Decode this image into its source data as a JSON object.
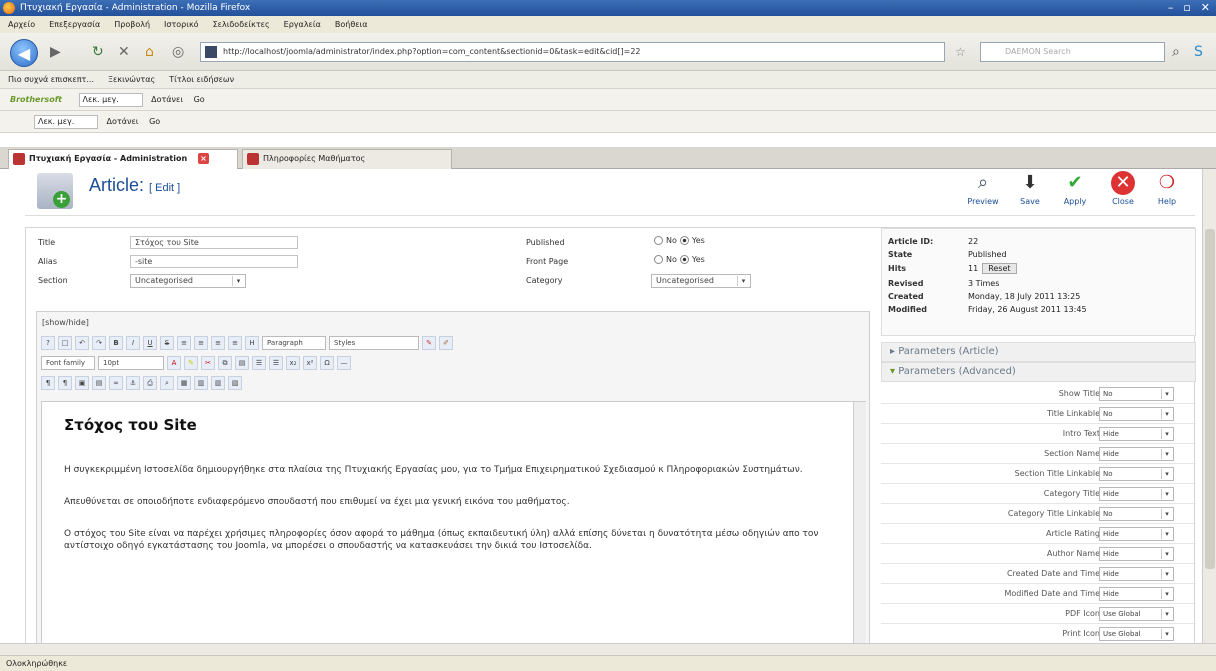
{
  "window": {
    "title": "Πτυχιακή Εργασία - Administration - Mozilla Firefox"
  },
  "menu": [
    "Αρχείο",
    "Επεξεργασία",
    "Προβολή",
    "Ιστορικό",
    "Σελιδοδείκτες",
    "Εργαλεία",
    "Βοήθεια"
  ],
  "nav": {
    "url": "http://localhost/joomla/administrator/index.php?option=com_content&sectionid=0&task=edit&cid[]=22",
    "search_placeholder": "DAEMON Search"
  },
  "bookmarks": [
    "Πιο συχνά επισκεπτ...",
    "Ξεκινώντας",
    "Τίτλοι ειδήσεων"
  ],
  "toolbar1": {
    "brand": "Brothersoft",
    "field": "Λεκ. μεγ.",
    "button": "Δοτάνει",
    "go": "Go"
  },
  "toolbar2": {
    "field": "Λεκ. μεγ.",
    "button": "Δοτάνει",
    "go": "Go"
  },
  "tabs": [
    "Πτυχιακή Εργασία - Administration",
    "Πληροφορίες Μαθήματος"
  ],
  "page": {
    "title": "Article:",
    "subtitle": "[ Edit ]",
    "buttons": [
      "Preview",
      "Save",
      "Apply",
      "Close",
      "Help"
    ]
  },
  "form": {
    "title_label": "Title",
    "title_value": "Στόχος του Site",
    "alias_label": "Alias",
    "alias_value": "-site",
    "section_label": "Section",
    "section_value": "Uncategorised",
    "published_label": "Published",
    "front_label": "Front Page",
    "category_label": "Category",
    "no": "No",
    "yes": "Yes",
    "category_value": "Uncategorised"
  },
  "editor": {
    "toggle": "[show/hide]",
    "paragraph": "Paragraph",
    "styles": "Styles",
    "font_family": "Font family",
    "font_size": "10pt",
    "heading": "Στόχος του Site",
    "p1": "Η συγκεκριμμένη Ιστοσελίδα δημιουργήθηκε στα πλαίσια της Πτυχιακής Εργασίας μου, για το Τμήμα Επιχειρηματικού Σχεδιασμού κ Πληροφοριακών Συστημάτων.",
    "p2": "Απευθύνεται σε οποιοδήποτε ενδιαφερόμενο σπουδαστή που επιθυμεί να έχει μια γενική εικόνα του μαθήματος.",
    "p3": "Ο στόχος του Site είναι να παρέχει χρήσιμες πληροφορίες όσον αφορά το μάθημα (όπως εκπαιδευτική ύλη) αλλά επίσης δύνεται η δυνατότητα μέσω οδηγιών απο τον αντίστοιχο οδηγό εγκατάστασης του Joomla, να μπορέσει ο σπουδαστής να κατασκευάσει την δικιά του Ιστοσελίδα."
  },
  "info": {
    "id_label": "Article ID:",
    "id_value": "22",
    "state_label": "State",
    "state_value": "Published",
    "hits_label": "Hits",
    "hits_value": "11",
    "reset": "Reset",
    "revised_label": "Revised",
    "revised_value": "3 Times",
    "created_label": "Created",
    "created_value": "Monday, 18 July 2011 13:25",
    "modified_label": "Modified",
    "modified_value": "Friday, 26 August 2011 13:45"
  },
  "params": {
    "article": "Parameters (Article)",
    "advanced": "Parameters (Advanced)",
    "rows": [
      {
        "label": "Show Title",
        "value": "No"
      },
      {
        "label": "Title Linkable",
        "value": "No"
      },
      {
        "label": "Intro Text",
        "value": "Hide"
      },
      {
        "label": "Section Name",
        "value": "Hide"
      },
      {
        "label": "Section Title Linkable",
        "value": "No"
      },
      {
        "label": "Category Title",
        "value": "Hide"
      },
      {
        "label": "Category Title Linkable",
        "value": "No"
      },
      {
        "label": "Article Rating",
        "value": "Hide"
      },
      {
        "label": "Author Name",
        "value": "Hide"
      },
      {
        "label": "Created Date and Time",
        "value": "Hide"
      },
      {
        "label": "Modified Date and Time",
        "value": "Hide"
      },
      {
        "label": "PDF Icon",
        "value": "Use Global"
      },
      {
        "label": "Print Icon",
        "value": "Use Global"
      }
    ]
  },
  "status": "Ολοκληρώθηκε"
}
